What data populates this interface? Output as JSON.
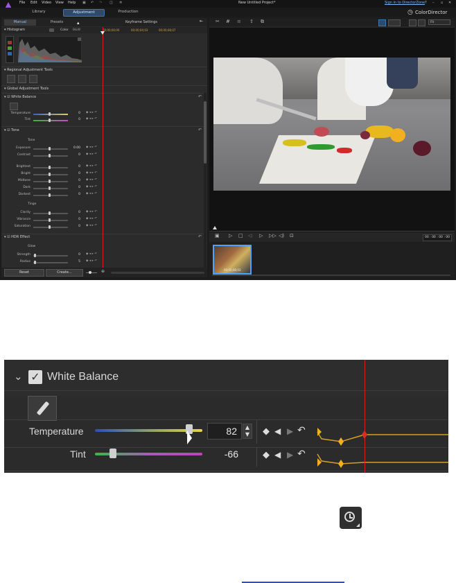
{
  "menu": [
    "File",
    "Edit",
    "Video",
    "View",
    "Help"
  ],
  "window_title": "New Untitled Project*",
  "sign_in": "Sign in to DirectorZone",
  "brand": "ColorDirector",
  "modes": {
    "library": "Library",
    "adjustment": "Adjustment",
    "production": "Production"
  },
  "left_tabs": {
    "manual": "Manual",
    "presets": "Presets"
  },
  "keyframe_settings": "Keyframe Settings",
  "histogram": {
    "title": "Histogram",
    "mode": "Color",
    "label2": "B&W"
  },
  "timeline_ruler": [
    "00;00;00;00",
    "00;00;04;03",
    "00;00;08;07"
  ],
  "regional_tools_title": "Regional Adjustment Tools",
  "global_tools_title": "Global Adjustment Tools",
  "white_balance": {
    "title": "White Balance",
    "temperature": {
      "label": "Temperature",
      "value": "0"
    },
    "tint": {
      "label": "Tint",
      "value": "0"
    }
  },
  "tone": {
    "title": "Tone",
    "subtitle": "Tone",
    "exposure": {
      "label": "Exposure",
      "value": "0.00"
    },
    "contrast": {
      "label": "Contrast",
      "value": "0"
    },
    "brightest": {
      "label": "Brightest",
      "value": "0"
    },
    "bright": {
      "label": "Bright",
      "value": "0"
    },
    "midtone": {
      "label": "Midtone",
      "value": "0"
    },
    "dark": {
      "label": "Dark",
      "value": "0"
    },
    "darkest": {
      "label": "Darkest",
      "value": "0"
    },
    "tinge": "Tinge",
    "clarity": {
      "label": "Clarity",
      "value": "0"
    },
    "vibrance": {
      "label": "Vibrance",
      "value": "0"
    },
    "saturation": {
      "label": "Saturation",
      "value": "0"
    }
  },
  "hdr": {
    "title": "HDR Effect",
    "subtitle": "Glow",
    "strength": {
      "label": "Strength",
      "value": "0"
    },
    "radius": {
      "label": "Radius",
      "value": "5"
    }
  },
  "buttons": {
    "reset": "Reset",
    "create": "Create..."
  },
  "fit": "Fit",
  "timecode": "00 : 00 : 00 : 00",
  "thumb_caption": "00;00;08;03",
  "zoom": {
    "title": "White Balance",
    "temperature": {
      "label": "Temperature",
      "value": "82",
      "level": 0.88
    },
    "tint": {
      "label": "Tint",
      "value": "-66",
      "level": 0.17
    }
  },
  "colors": {
    "accent": "#3c78b0",
    "playhead": "#d42020",
    "keyframe": "#f0b020"
  }
}
